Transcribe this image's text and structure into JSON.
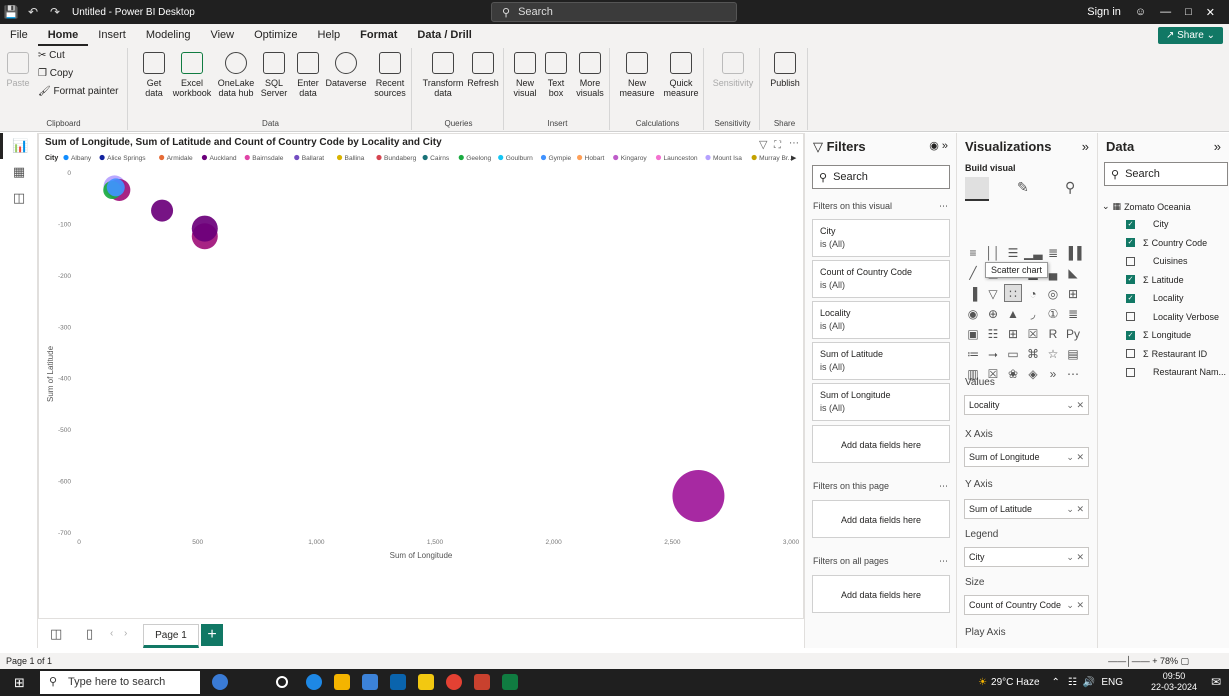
{
  "window": {
    "title": "Untitled - Power BI Desktop",
    "search_placeholder": "Search",
    "sign_in": "Sign in"
  },
  "tabs": [
    "File",
    "Home",
    "Insert",
    "Modeling",
    "View",
    "Optimize",
    "Help",
    "Format",
    "Data / Drill"
  ],
  "active_tab": "Home",
  "share_label": "Share",
  "ribbon": {
    "clipboard": {
      "label": "Clipboard",
      "paste": "Paste",
      "cut": "Cut",
      "copy": "Copy",
      "format_painter": "Format painter"
    },
    "data": {
      "label": "Data",
      "get_data": "Get\ndata",
      "excel": "Excel\nworkbook",
      "onelake": "OneLake\ndata hub",
      "sql": "SQL\nServer",
      "enter": "Enter\ndata",
      "dataverse": "Dataverse",
      "recent": "Recent\nsources"
    },
    "queries": {
      "label": "Queries",
      "transform": "Transform\ndata",
      "refresh": "Refresh"
    },
    "insert": {
      "label": "Insert",
      "new_visual": "New\nvisual",
      "text_box": "Text\nbox",
      "more": "More\nvisuals"
    },
    "calculations": {
      "label": "Calculations",
      "new_measure": "New\nmeasure",
      "quick_measure": "Quick\nmeasure"
    },
    "sensitivity": {
      "label": "Sensitivity",
      "btn": "Sensitivity"
    },
    "share": {
      "label": "Share",
      "publish": "Publish"
    }
  },
  "chart_data": {
    "type": "scatter",
    "title": "Sum of Longitude, Sum of Latitude and Count of Country Code by Locality and City",
    "legend_title": "City",
    "legend": [
      {
        "name": "Albany",
        "color": "#118DFF"
      },
      {
        "name": "Alice Springs",
        "color": "#12239E"
      },
      {
        "name": "Armidale",
        "color": "#E66C37"
      },
      {
        "name": "Auckland",
        "color": "#6B007B"
      },
      {
        "name": "Bairnsdale",
        "color": "#E044A7"
      },
      {
        "name": "Ballarat",
        "color": "#744EC2"
      },
      {
        "name": "Ballina",
        "color": "#D9B300"
      },
      {
        "name": "Bundaberg",
        "color": "#D64550"
      },
      {
        "name": "Cairns",
        "color": "#197278"
      },
      {
        "name": "Geelong",
        "color": "#1AAB40"
      },
      {
        "name": "Goulburn",
        "color": "#15C6F4"
      },
      {
        "name": "Gympie",
        "color": "#4092FF"
      },
      {
        "name": "Hobart",
        "color": "#FFA058"
      },
      {
        "name": "Kingaroy",
        "color": "#BE5DC9"
      },
      {
        "name": "Launceston",
        "color": "#F472D0"
      },
      {
        "name": "Mount Isa",
        "color": "#B5A1FF"
      },
      {
        "name": "Murray Br...",
        "color": "#C4A200"
      }
    ],
    "xlabel": "Sum of Longitude",
    "ylabel": "Sum of Latitude",
    "xlim": [
      0,
      3000
    ],
    "ylim": [
      -700,
      0
    ],
    "x_ticks": [
      "0",
      "500",
      "1,000",
      "1,500",
      "2,000",
      "2,500",
      "3,000"
    ],
    "y_ticks": [
      "0",
      "-100",
      "-200",
      "-300",
      "-400",
      "-500",
      "-600",
      "-700"
    ],
    "points": [
      {
        "x": 150,
        "y": -28,
        "color": "#B5A1FF"
      },
      {
        "x": 170,
        "y": -35,
        "color": "#A0117A"
      },
      {
        "x": 140,
        "y": -35,
        "color": "#1AAB40"
      },
      {
        "x": 155,
        "y": -30,
        "color": "#4092FF"
      },
      {
        "x": 350,
        "y": -75,
        "color": "#6B007B"
      },
      {
        "x": 530,
        "y": -125,
        "color": "#A0117A"
      },
      {
        "x": 530,
        "y": -110,
        "color": "#6B007B"
      },
      {
        "x": 2610,
        "y": -630,
        "color": "#A0179A"
      }
    ]
  },
  "filters": {
    "title": "Filters",
    "search": "Search",
    "on_visual": "Filters on this visual",
    "cards": [
      {
        "name": "City",
        "value": "is (All)"
      },
      {
        "name": "Count of Country Code",
        "value": "is (All)"
      },
      {
        "name": "Locality",
        "value": "is (All)"
      },
      {
        "name": "Sum of Latitude",
        "value": "is (All)"
      },
      {
        "name": "Sum of Longitude",
        "value": "is (All)"
      }
    ],
    "add_fields": "Add data fields here",
    "on_page": "Filters on this page",
    "on_all": "Filters on all pages"
  },
  "visualizations": {
    "title": "Visualizations",
    "build": "Build visual",
    "tooltip": "Scatter chart",
    "wells": [
      {
        "label": "Values",
        "field": "Locality"
      },
      {
        "label": "X Axis",
        "field": "Sum of Longitude"
      },
      {
        "label": "Y Axis",
        "field": "Sum of Latitude"
      },
      {
        "label": "Legend",
        "field": "City"
      },
      {
        "label": "Size",
        "field": "Count of Country Code"
      }
    ],
    "play_axis": "Play Axis"
  },
  "data_pane": {
    "title": "Data",
    "search": "Search",
    "table": "Zomato Oceania",
    "fields": [
      {
        "name": "City",
        "checked": true,
        "sigma": false
      },
      {
        "name": "Country Code",
        "checked": true,
        "sigma": true
      },
      {
        "name": "Cuisines",
        "checked": false,
        "sigma": false
      },
      {
        "name": "Latitude",
        "checked": true,
        "sigma": true
      },
      {
        "name": "Locality",
        "checked": true,
        "sigma": false
      },
      {
        "name": "Locality Verbose",
        "checked": false,
        "sigma": false
      },
      {
        "name": "Longitude",
        "checked": true,
        "sigma": true
      },
      {
        "name": "Restaurant ID",
        "checked": false,
        "sigma": true
      },
      {
        "name": "Restaurant Nam...",
        "checked": false,
        "sigma": false
      }
    ]
  },
  "page_tab": "Page 1",
  "status": {
    "page": "Page 1 of 1",
    "zoom": "78%"
  },
  "taskbar": {
    "search": "Type here to search",
    "weather": "29°C Haze",
    "lang": "ENG",
    "time": "09:50",
    "date": "22-03-2024"
  }
}
